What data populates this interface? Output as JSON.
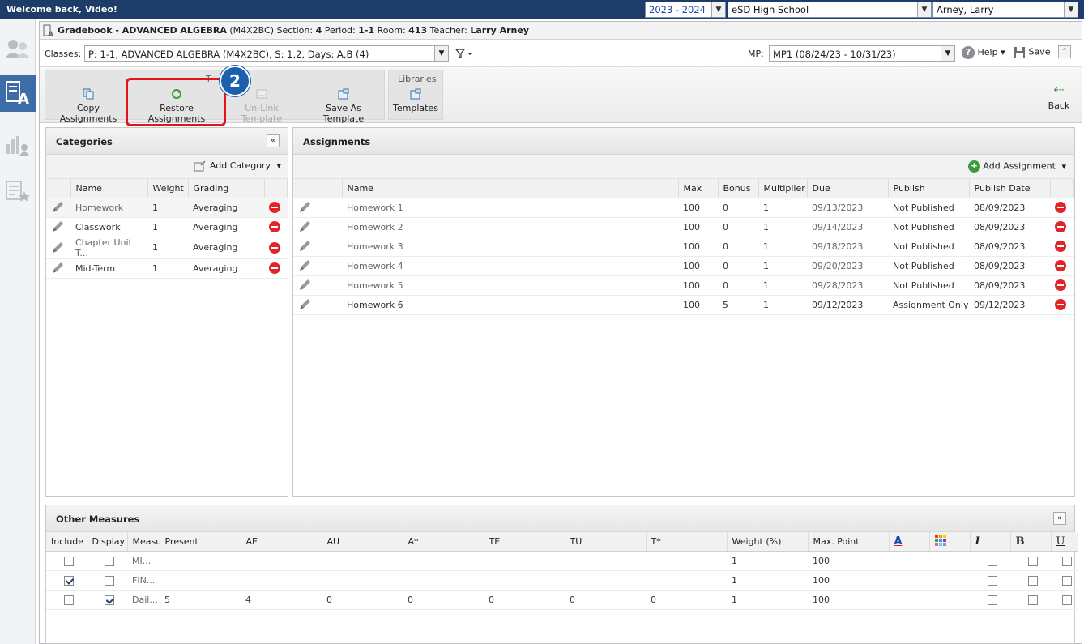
{
  "topbar": {
    "welcome": "Welcome back, Video!",
    "year": "2023 - 2024",
    "school": "eSD High School",
    "teacher": "Arney, Larry"
  },
  "title": {
    "prefix": "Gradebook - ADVANCED ALGEBRA",
    "code": "(M4X2BC)",
    "section_label": "Section:",
    "section": "4",
    "period_label": "Period:",
    "period": "1-1",
    "room_label": "Room:",
    "room": "413",
    "teacher_label": "Teacher:",
    "teacher": "Larry Arney"
  },
  "classbar": {
    "classes_label": "Classes:",
    "class_value": "P: 1-1, ADVANCED ALGEBRA (M4X2BC), S: 1,2, Days: A,B (4)",
    "mp_label": "MP:",
    "mp_value": "MP1 (08/24/23 - 10/31/23)",
    "help": "Help",
    "save": "Save"
  },
  "ribbon": {
    "group_label_partial": "T",
    "copy": "Copy Assignments",
    "restore": "Restore Assignments",
    "unlink": "Un-Link Template",
    "saveas": "Save As Template",
    "libraries": "Libraries",
    "templates": "Templates",
    "back": "Back",
    "step": "2"
  },
  "categories": {
    "title": "Categories",
    "add": "Add Category",
    "headers": [
      "Name",
      "Weight",
      "Grading"
    ],
    "rows": [
      {
        "name": "Homework",
        "weight": "1",
        "grading": "Averaging"
      },
      {
        "name": "Classwork",
        "weight": "1",
        "grading": "Averaging"
      },
      {
        "name": "Chapter Unit T...",
        "weight": "1",
        "grading": "Averaging"
      },
      {
        "name": "Mid-Term",
        "weight": "1",
        "grading": "Averaging"
      }
    ]
  },
  "assignments": {
    "title": "Assignments",
    "add": "Add Assignment",
    "headers": [
      "Name",
      "Max",
      "Bonus",
      "Multiplier",
      "Due",
      "Publish",
      "Publish Date"
    ],
    "rows": [
      {
        "name": "Homework 1",
        "max": "100",
        "bonus": "0",
        "mult": "1",
        "due": "09/13/2023",
        "publish": "Not Published",
        "pdate": "08/09/2023"
      },
      {
        "name": "Homework 2",
        "max": "100",
        "bonus": "0",
        "mult": "1",
        "due": "09/14/2023",
        "publish": "Not Published",
        "pdate": "08/09/2023"
      },
      {
        "name": "Homework 3",
        "max": "100",
        "bonus": "0",
        "mult": "1",
        "due": "09/18/2023",
        "publish": "Not Published",
        "pdate": "08/09/2023"
      },
      {
        "name": "Homework 4",
        "max": "100",
        "bonus": "0",
        "mult": "1",
        "due": "09/20/2023",
        "publish": "Not Published",
        "pdate": "08/09/2023"
      },
      {
        "name": "Homework 5",
        "max": "100",
        "bonus": "0",
        "mult": "1",
        "due": "09/28/2023",
        "publish": "Not Published",
        "pdate": "08/09/2023"
      },
      {
        "name": "Homework 6",
        "max": "100",
        "bonus": "5",
        "mult": "1",
        "due": "09/12/2023",
        "publish": "Assignment Only",
        "pdate": "09/12/2023"
      }
    ]
  },
  "measures": {
    "title": "Other Measures",
    "headers": [
      "Include",
      "Display",
      "Measu",
      "Present",
      "AE",
      "AU",
      "A*",
      "TE",
      "TU",
      "T*",
      "Weight (%)",
      "Max. Point"
    ],
    "fmt_italic": "I",
    "fmt_bold": "B",
    "fmt_underline": "U",
    "rows": [
      {
        "include": false,
        "display": false,
        "name": "MI...",
        "present": "",
        "ae": "",
        "au": "",
        "astar": "",
        "te": "",
        "tu": "",
        "tstar": "",
        "weight": "1",
        "max": "100"
      },
      {
        "include": true,
        "display": false,
        "name": "FIN...",
        "present": "",
        "ae": "",
        "au": "",
        "astar": "",
        "te": "",
        "tu": "",
        "tstar": "",
        "weight": "1",
        "max": "100"
      },
      {
        "include": false,
        "display": true,
        "name": "Dail...",
        "present": "5",
        "ae": "4",
        "au": "0",
        "astar": "0",
        "te": "0",
        "tu": "0",
        "tstar": "0",
        "weight": "1",
        "max": "100"
      }
    ]
  }
}
